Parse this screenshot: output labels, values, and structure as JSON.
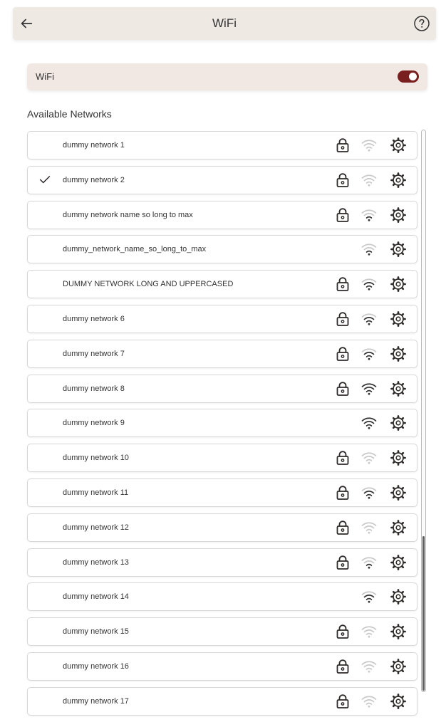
{
  "header": {
    "title": "WiFi",
    "back_icon": "arrow-left-icon",
    "help_icon": "question-circle-icon",
    "background": "#efe9e4"
  },
  "wifi_toggle": {
    "label": "WiFi",
    "enabled": true,
    "accent": "#7a1f1f",
    "background": "#f1e8e4"
  },
  "networks": {
    "title": "Available Networks",
    "items": [
      {
        "name": "dummy network 1",
        "connected": false,
        "secured": true,
        "signal": 0
      },
      {
        "name": "dummy network 2",
        "connected": true,
        "secured": true,
        "signal": 0
      },
      {
        "name": "dummy network name so long to max",
        "connected": false,
        "secured": true,
        "signal": 1
      },
      {
        "name": "dummy_network_name_so_long_to_max",
        "connected": false,
        "secured": false,
        "signal": 1
      },
      {
        "name": "DUMMY NETWORK LONG AND UPPERCASED",
        "connected": false,
        "secured": true,
        "signal": 2
      },
      {
        "name": "dummy network 6",
        "connected": false,
        "secured": true,
        "signal": 2
      },
      {
        "name": "dummy network 7",
        "connected": false,
        "secured": true,
        "signal": 2
      },
      {
        "name": "dummy network 8",
        "connected": false,
        "secured": true,
        "signal": 3
      },
      {
        "name": "dummy network 9",
        "connected": false,
        "secured": false,
        "signal": 3
      },
      {
        "name": "dummy network 10",
        "connected": false,
        "secured": true,
        "signal": 0
      },
      {
        "name": "dummy network 11",
        "connected": false,
        "secured": true,
        "signal": 2
      },
      {
        "name": "dummy network 12",
        "connected": false,
        "secured": true,
        "signal": 0
      },
      {
        "name": "dummy network 13",
        "connected": false,
        "secured": true,
        "signal": 1
      },
      {
        "name": "dummy network 14",
        "connected": false,
        "secured": false,
        "signal": 2
      },
      {
        "name": "dummy network 15",
        "connected": false,
        "secured": true,
        "signal": 0
      },
      {
        "name": "dummy network 16",
        "connected": false,
        "secured": true,
        "signal": 0
      },
      {
        "name": "dummy network 17",
        "connected": false,
        "secured": true,
        "signal": 0
      }
    ]
  },
  "icons": {
    "check": "check-icon",
    "lock": "lock-icon",
    "signal": "wifi-signal-icon",
    "settings": "gear-icon"
  },
  "scrollbar": {
    "position": 0.72
  }
}
